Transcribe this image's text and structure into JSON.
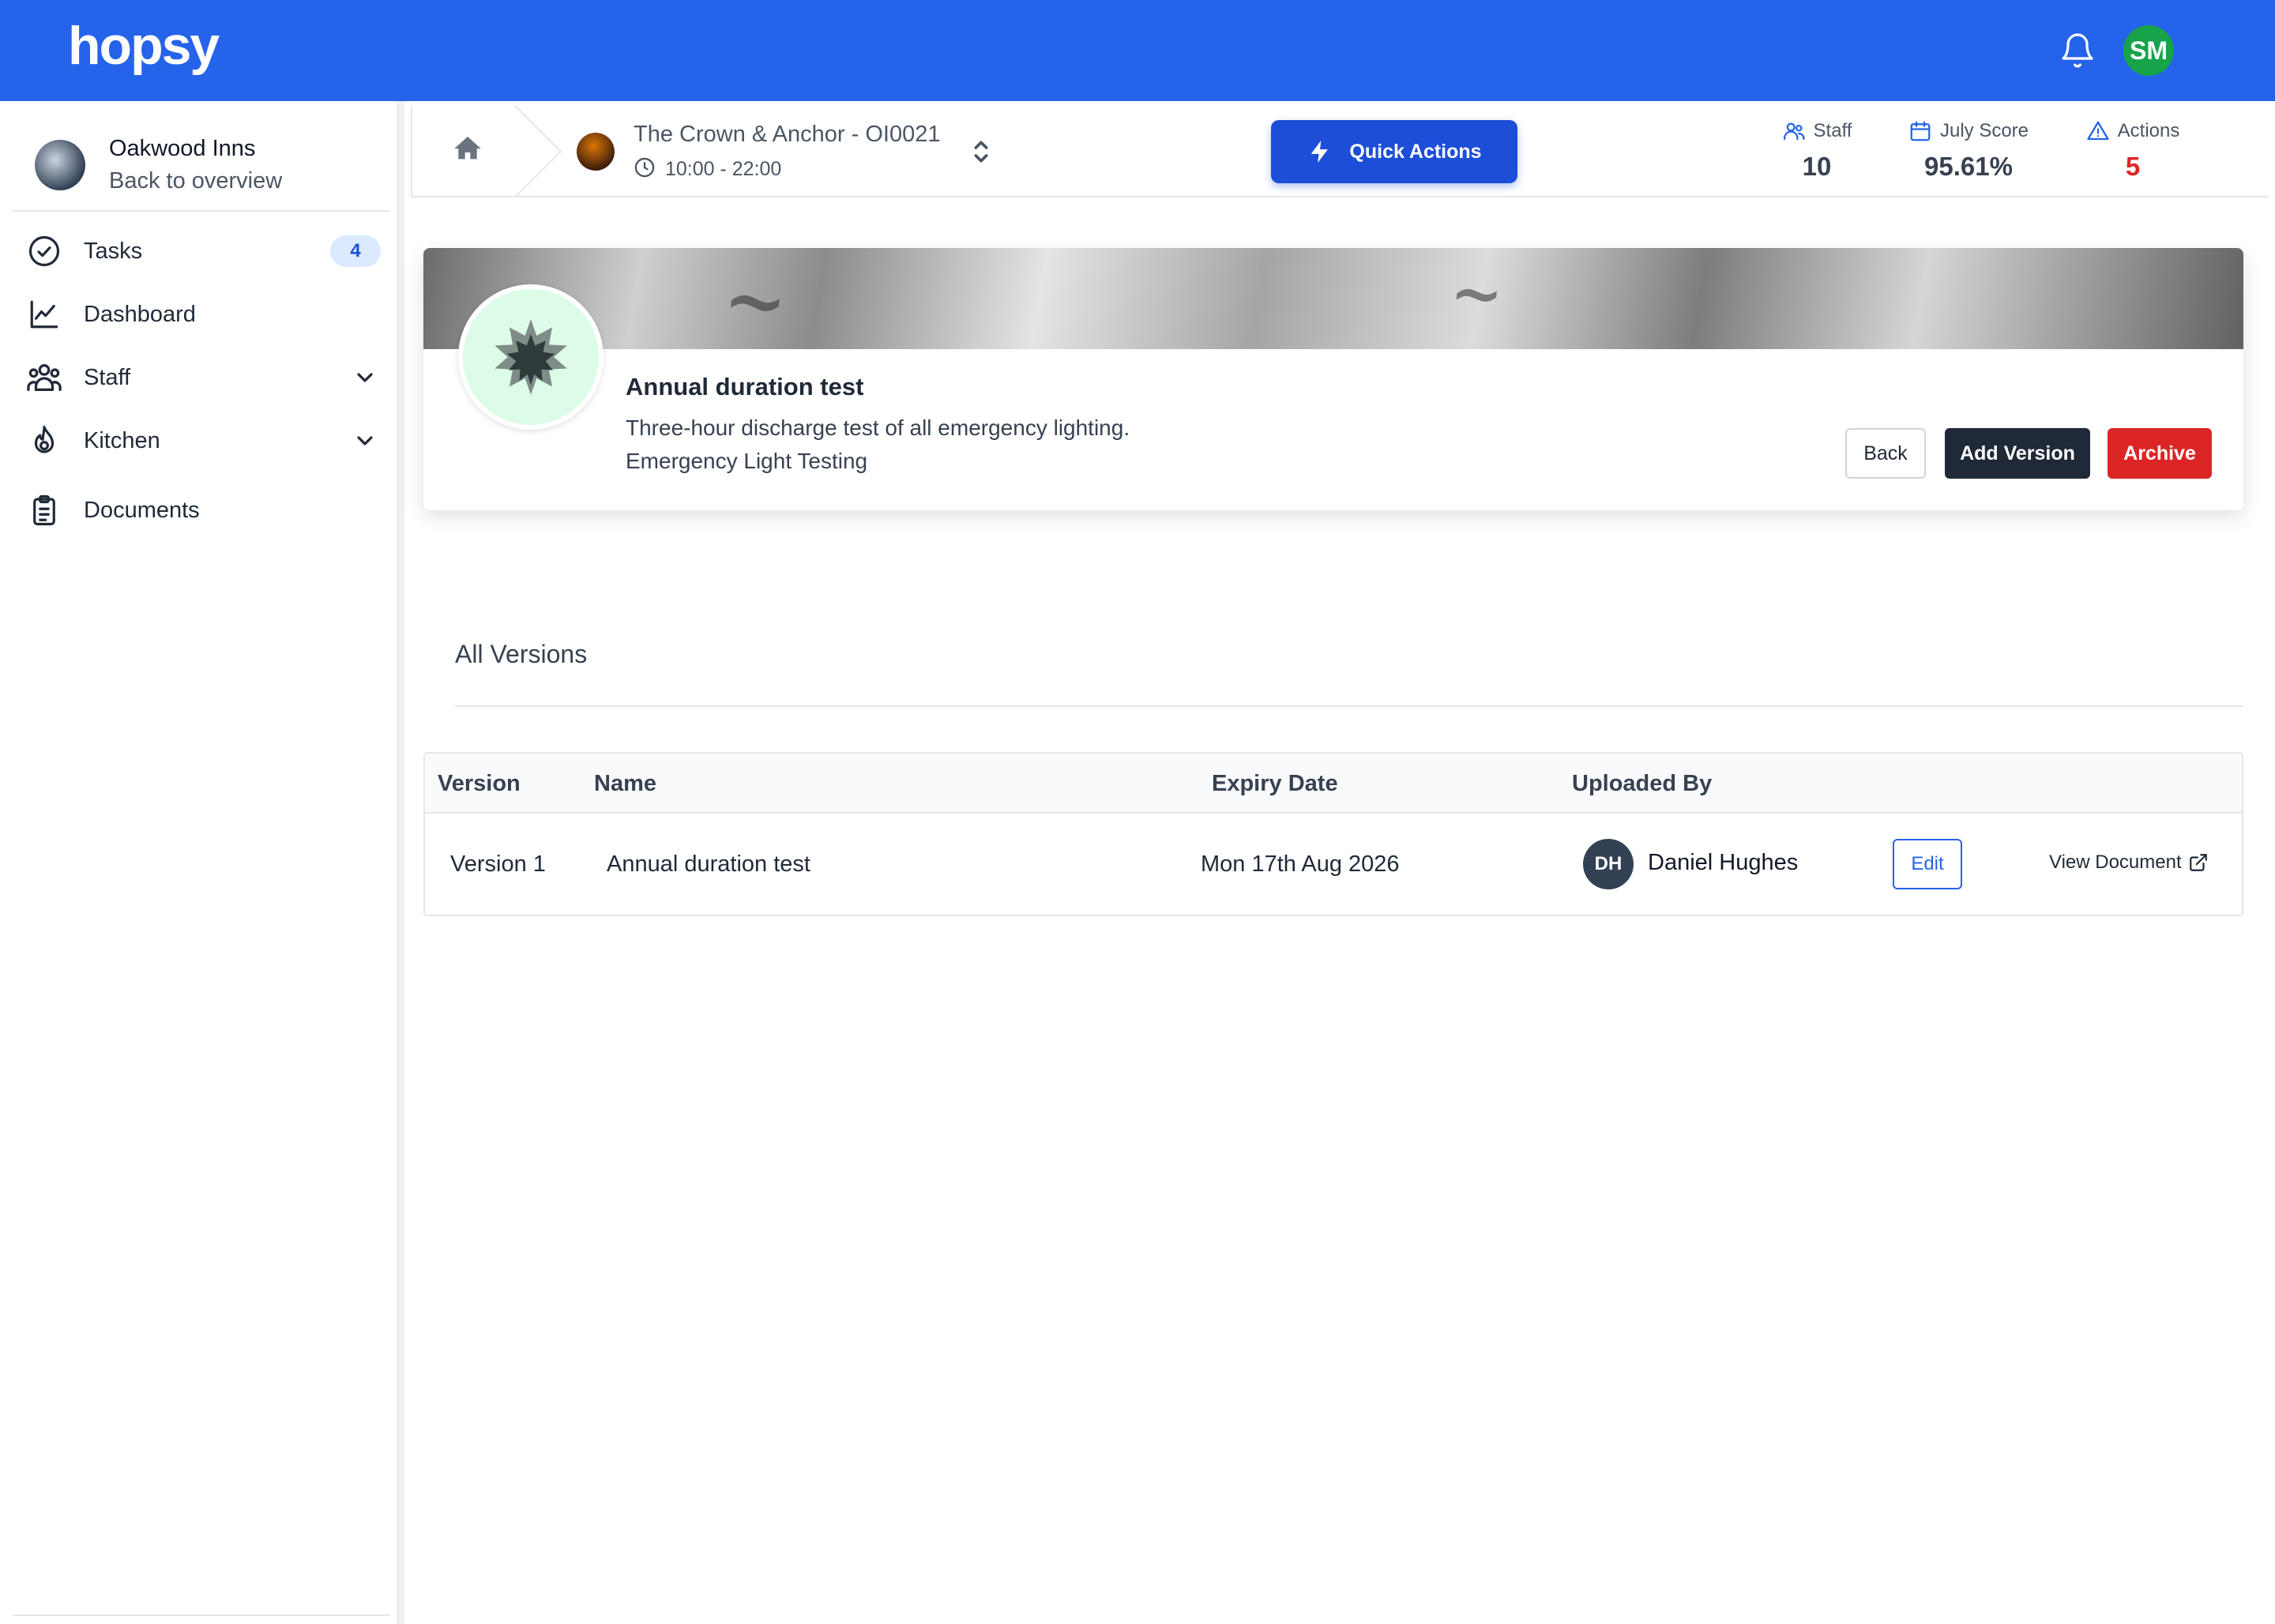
{
  "app": {
    "logo": "hopsy",
    "user_initials": "SM",
    "colors": {
      "brand": "#2563eb",
      "success": "#16a34a",
      "danger": "#dc2626",
      "dark": "#1f2937"
    }
  },
  "sidebar": {
    "org_name": "Oakwood Inns",
    "back_label": "Back to overview",
    "items": [
      {
        "label": "Tasks",
        "icon": "check-circle-icon",
        "badge": "4"
      },
      {
        "label": "Dashboard",
        "icon": "chart-line-icon"
      },
      {
        "label": "Staff",
        "icon": "users-icon",
        "expandable": true
      },
      {
        "label": "Kitchen",
        "icon": "flame-icon",
        "expandable": true
      },
      {
        "label": "Documents",
        "icon": "clipboard-icon"
      }
    ]
  },
  "header": {
    "site_name": "The Crown & Anchor - OI0021",
    "site_hours": "10:00 - 22:00",
    "quick_actions_label": "Quick Actions",
    "stats": [
      {
        "label": "Staff",
        "value": "10",
        "icon": "users-icon"
      },
      {
        "label": "July Score",
        "value": "95.61%",
        "icon": "calendar-icon"
      },
      {
        "label": "Actions",
        "value": "5",
        "icon": "warning-icon",
        "color": "#dc2626"
      }
    ]
  },
  "document": {
    "title": "Annual duration test",
    "description": "Three-hour discharge test of all emergency lighting.",
    "category": "Emergency Light Testing",
    "buttons": {
      "back": "Back",
      "add_version": "Add Version",
      "archive": "Archive"
    }
  },
  "versions": {
    "section_title": "All Versions",
    "columns": [
      "Version",
      "Name",
      "Expiry Date",
      "Uploaded By"
    ],
    "rows": [
      {
        "version": "Version 1",
        "name": "Annual duration test",
        "expiry": "Mon 17th Aug 2026",
        "uploader_initials": "DH",
        "uploader": "Daniel Hughes",
        "edit_label": "Edit",
        "view_label": "View Document"
      }
    ]
  }
}
